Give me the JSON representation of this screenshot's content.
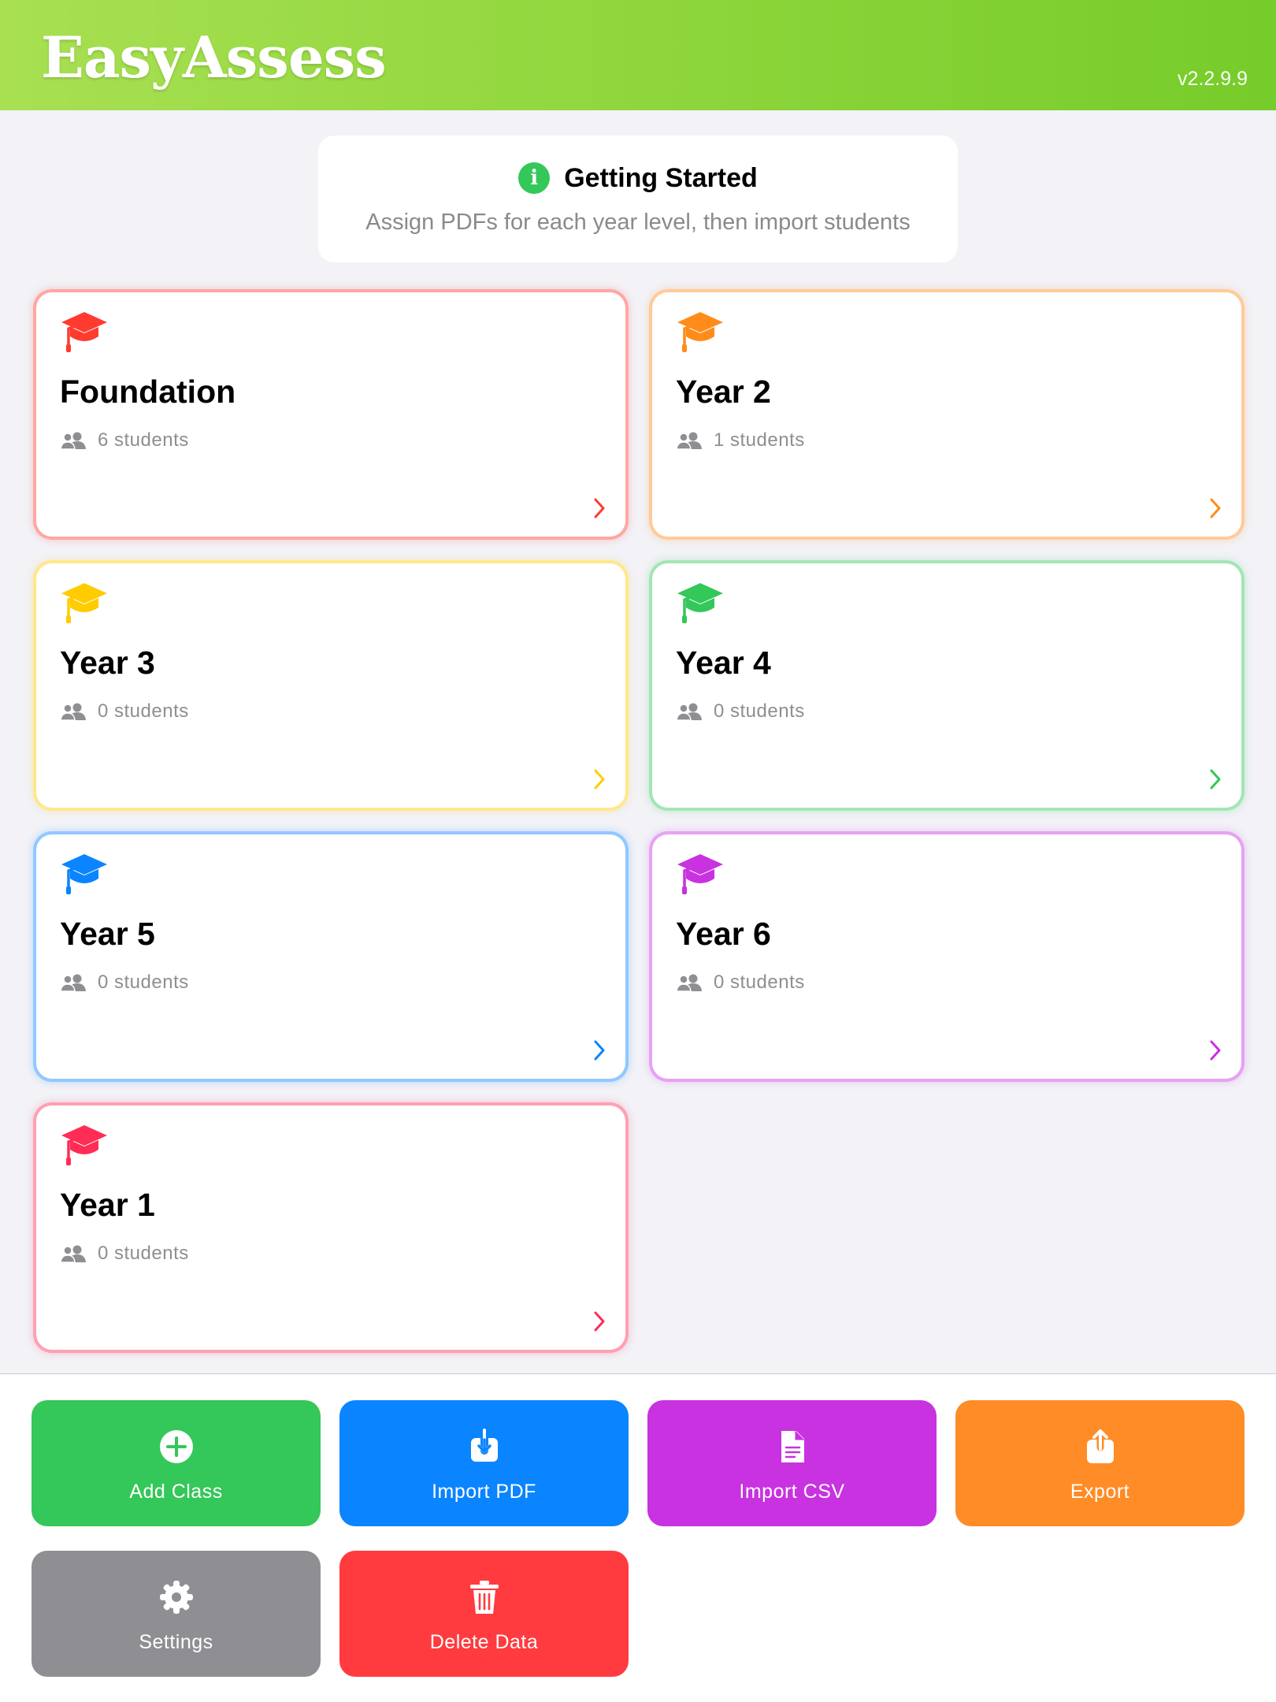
{
  "header": {
    "logo": "EasyAssess",
    "version": "v2.2.9.9"
  },
  "getting_started": {
    "icon": "info-icon",
    "title": "Getting Started",
    "subtitle": "Assign PDFs for each year level, then import students"
  },
  "classes": [
    {
      "name": "Foundation",
      "count": "6 students",
      "color": "#ff3b30"
    },
    {
      "name": "Year 2",
      "count": "1 students",
      "color": "#ff8c1a"
    },
    {
      "name": "Year 3",
      "count": "0 students",
      "color": "#ffcc00"
    },
    {
      "name": "Year 4",
      "count": "0 students",
      "color": "#34c759"
    },
    {
      "name": "Year 5",
      "count": "0 students",
      "color": "#0a84ff"
    },
    {
      "name": "Year 6",
      "count": "0 students",
      "color": "#c832e0"
    },
    {
      "name": "Year 1",
      "count": "0 students",
      "color": "#ff2d55"
    }
  ],
  "actions": [
    {
      "label": "Add Class",
      "icon": "plus-circle-icon",
      "color": "#34c759"
    },
    {
      "label": "Import PDF",
      "icon": "download-tray-icon",
      "color": "#0a84ff"
    },
    {
      "label": "Import CSV",
      "icon": "document-icon",
      "color": "#c832e0"
    },
    {
      "label": "Export",
      "icon": "share-icon",
      "color": "#ff8c26"
    },
    {
      "label": "Settings",
      "icon": "gear-icon",
      "color": "#8e8e93"
    },
    {
      "label": "Delete Data",
      "icon": "trash-icon",
      "color": "#ff3b3f"
    }
  ]
}
